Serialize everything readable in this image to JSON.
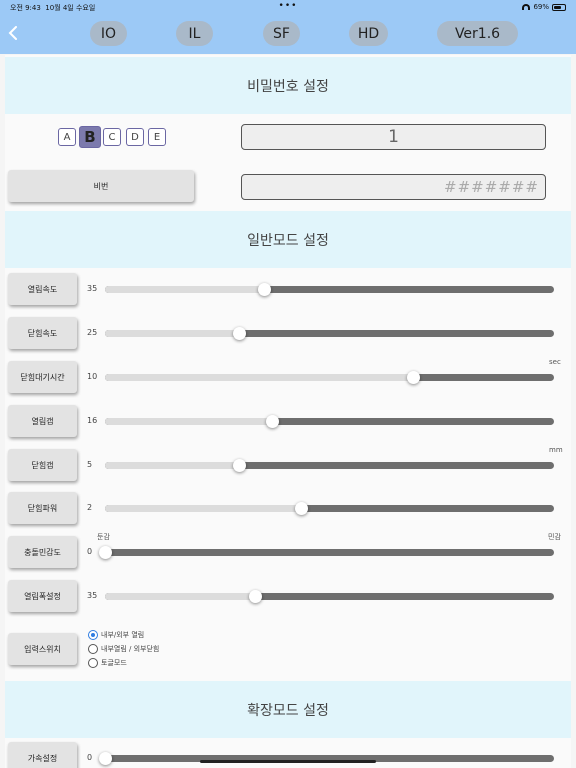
{
  "status": {
    "time": "오전 9:43",
    "date": "10월 4일 수요일",
    "dots": "•••",
    "battery": "69%",
    "battery_level": 0.69
  },
  "nav": {
    "items": [
      "IO",
      "IL",
      "SF",
      "HD",
      "Ver1.6"
    ]
  },
  "password": {
    "title": "비밀번호 설정",
    "letters": [
      "A",
      "B",
      "C",
      "D",
      "E"
    ],
    "selected_letter": "B",
    "value": "1",
    "button_label": "비번",
    "placeholder": "#######"
  },
  "general": {
    "title": "일반모드 설정",
    "rows": [
      {
        "label": "열림속도",
        "value": "35",
        "fraction": 0.355
      },
      {
        "label": "닫힘속도",
        "value": "25",
        "fraction": 0.298
      },
      {
        "label": "닫힘대기시간",
        "value": "10",
        "fraction": 0.686,
        "unit": "sec"
      },
      {
        "label": "열림갭",
        "value": "16",
        "fraction": 0.373
      },
      {
        "label": "닫힘갭",
        "value": "5",
        "fraction": 0.298,
        "unit": "mm"
      },
      {
        "label": "닫힘파워",
        "value": "2",
        "fraction": 0.437
      },
      {
        "label": "충돌민감도",
        "value": "0",
        "fraction": 0.0,
        "left_label": "둔감",
        "right_label": "민감"
      },
      {
        "label": "열림폭설정",
        "value": "35",
        "fraction": 0.334
      }
    ],
    "input_switch": {
      "label": "입력스위치",
      "options": [
        "내부/외부 열림",
        "내부열림 / 외부닫힘",
        "토글모드"
      ],
      "selected": 0
    }
  },
  "extended": {
    "title": "확장모드 설정",
    "rows": [
      {
        "label": "가속설정",
        "value": "0",
        "fraction": 0.0
      }
    ]
  },
  "colors": {
    "header_bg": "#9cc9f6",
    "section_bg": "#e1f5fb",
    "accent": "#7c7aad",
    "radio": "#2f7de1"
  }
}
